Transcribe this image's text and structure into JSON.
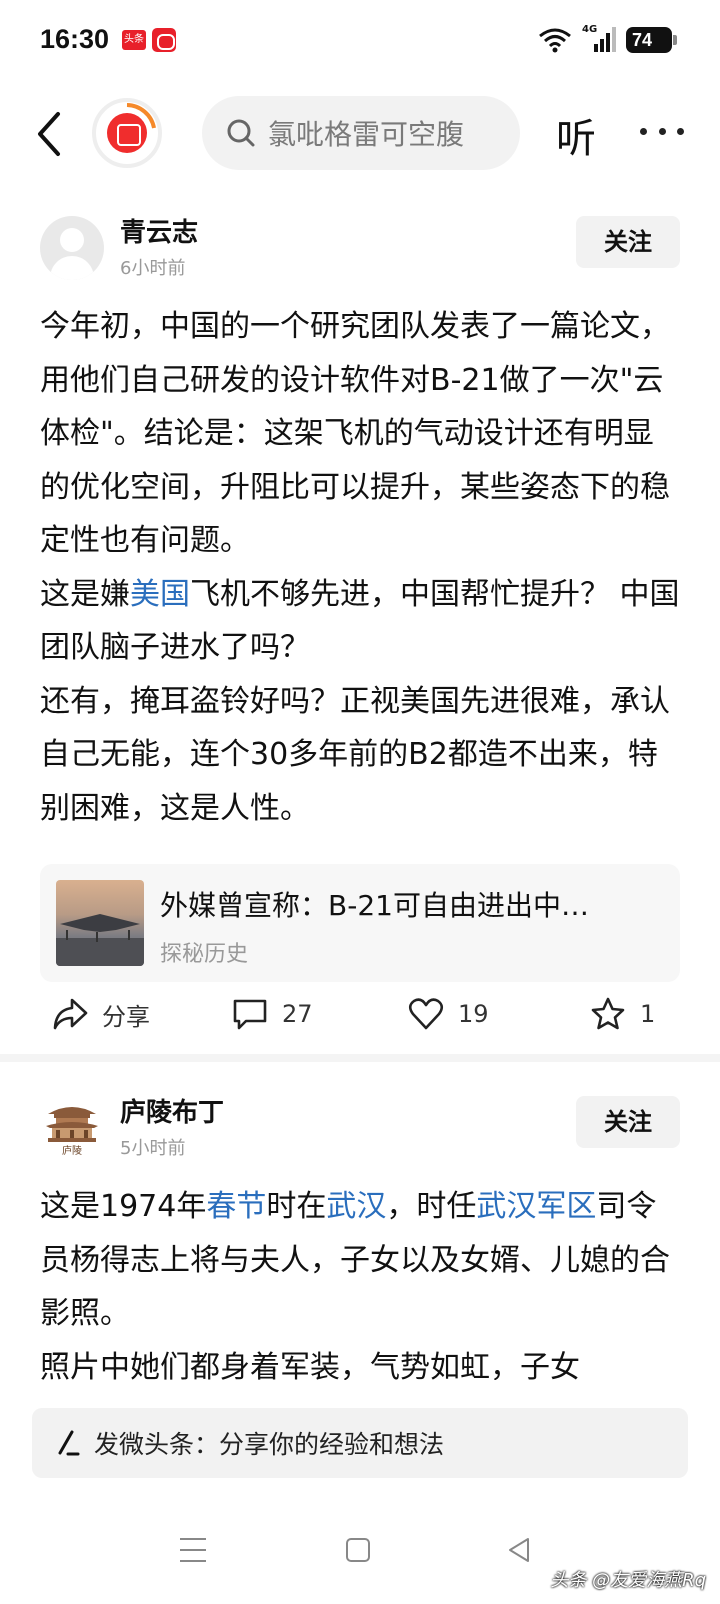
{
  "status_bar": {
    "time": "16:30",
    "badge_toutiao": "头条",
    "network": "4G",
    "battery": "74"
  },
  "nav": {
    "search_placeholder": "氯吡格雷可空腹",
    "listen_label": "听"
  },
  "posts": [
    {
      "author": "青云志",
      "time": "6小时前",
      "follow_label": "关注",
      "body_segments": [
        "今年初，中国的一个研究团队发表了一篇论文，用他们自己研发的设计软件对B-21做了一次\"云体检\"。结论是：这架飞机的气动设计还有明显的优化空间，升阻比可以提升，某些姿态下的稳定性也有问题。",
        "这是嫌",
        "美国",
        "飞机不够先进，中国帮忙提升？ 中国团队脑子进水了吗？",
        "还有，掩耳盗铃好吗？正视美国先进很难，承认自己无能，连个30多年前的B2都造不出来，特别困难，这是人性。"
      ],
      "card": {
        "title": "外媒曾宣称：B-21可自由进出中…",
        "source": "探秘历史"
      },
      "actions": {
        "share_label": "分享",
        "comments": "27",
        "likes": "19",
        "favorites": "1"
      }
    },
    {
      "author": "庐陵布丁",
      "time": "5小时前",
      "follow_label": "关注",
      "body_segments": [
        "这是1974年",
        "春节",
        "时在",
        "武汉",
        "，时任",
        "武汉军区",
        "司令员杨得志上将与夫人，子女以及女婿、儿媳的合影照。",
        "照片中她们都身着军装，气势如虹，子女"
      ],
      "avatar_text": "庐陵"
    }
  ],
  "composer": {
    "placeholder": "发微头条：分享你的经验和想法"
  },
  "watermark": "头条 @友爱海燕Rq",
  "colors": {
    "link": "#2a6ebd",
    "brand_red": "#f02d2d",
    "progress_orange": "#f5892a"
  }
}
